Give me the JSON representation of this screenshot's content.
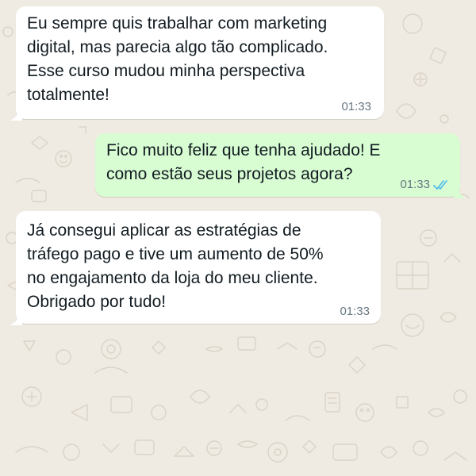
{
  "chat": {
    "messages": [
      {
        "direction": "incoming",
        "text": "Eu sempre quis trabalhar com marketing\ndigital, mas parecia algo tão complicado.\nEsse curso mudou minha perspectiva\ntotalmente!",
        "time": "01:33"
      },
      {
        "direction": "outgoing",
        "text": "Fico muito feliz que tenha ajudado! E\ncomo estão seus projetos agora?",
        "time": "01:33",
        "status_icon": "double-check-read-icon"
      },
      {
        "direction": "incoming",
        "text": "Já consegui aplicar as estratégias de\ntráfego pago e tive um aumento de 50%\nno engajamento da loja do meu cliente.\nObrigado por tudo!",
        "time": "01:33"
      }
    ]
  },
  "colors": {
    "wallpaper": "#efeae2",
    "incoming_bubble": "#ffffff",
    "outgoing_bubble": "#d9fdd3",
    "read_ticks": "#53bdeb",
    "timestamp": "#667781"
  }
}
